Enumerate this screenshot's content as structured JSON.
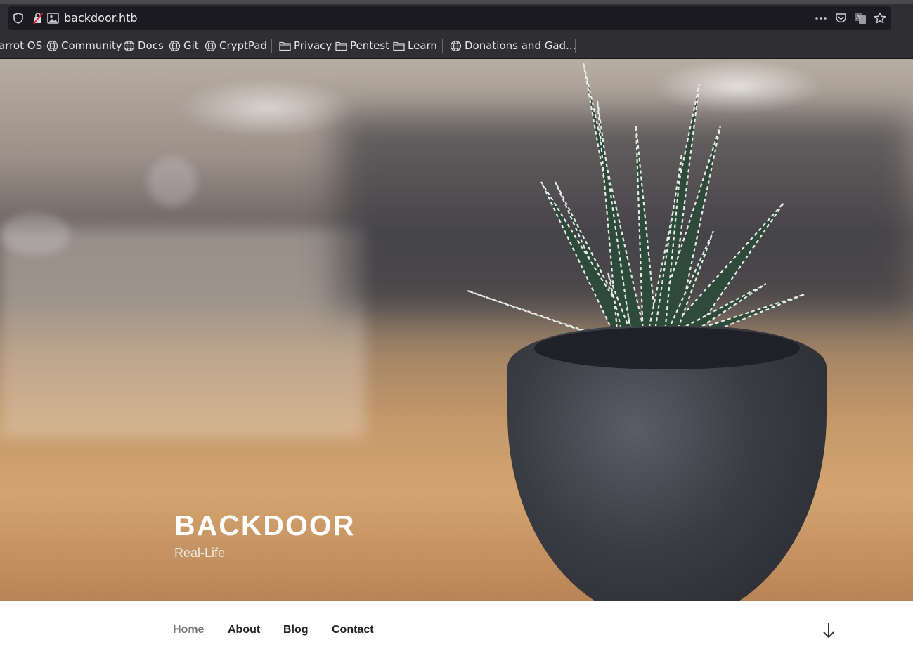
{
  "browser": {
    "url": "backdoor.htb",
    "bookmarks": [
      {
        "label": "arrot OS",
        "icon": "none"
      },
      {
        "label": "Community",
        "icon": "globe-icon"
      },
      {
        "label": "Docs",
        "icon": "globe-icon"
      },
      {
        "label": "Git",
        "icon": "globe-icon"
      },
      {
        "label": "CryptPad",
        "icon": "globe-icon"
      },
      {
        "label": "Privacy",
        "icon": "folder-icon"
      },
      {
        "label": "Pentest",
        "icon": "folder-icon"
      },
      {
        "label": "Learn",
        "icon": "folder-icon"
      },
      {
        "label": "Donations and Gad...",
        "icon": "globe-icon"
      }
    ],
    "toolbar_icons": [
      "shield-icon",
      "insecure-lock-icon",
      "image-icon",
      "more-icon",
      "pocket-icon",
      "translate-icon",
      "bookmark-star-icon"
    ]
  },
  "site": {
    "title": "BACKDOOR",
    "tagline": "Real-Life"
  },
  "nav": {
    "items": [
      {
        "label": "Home",
        "active": true
      },
      {
        "label": "About",
        "active": false
      },
      {
        "label": "Blog",
        "active": false
      },
      {
        "label": "Contact",
        "active": false
      }
    ],
    "scroll_icon": "arrow-down-icon"
  },
  "colors": {
    "chrome_bg": "#2f2f31",
    "urlbar_bg": "#1c1b22",
    "nav_text": "#222222",
    "nav_active": "#767676",
    "title_text": "#ffffff"
  }
}
